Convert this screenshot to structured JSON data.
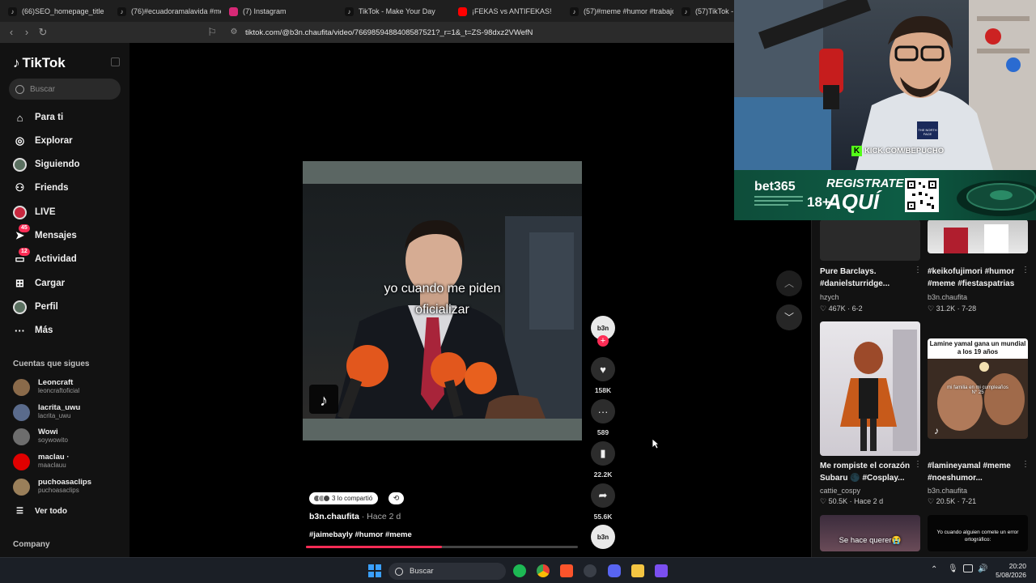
{
  "browser": {
    "tabs": [
      {
        "title": "(66)SEO_homepage_title",
        "color": "#111111",
        "icon": "tiktok-icon"
      },
      {
        "title": "(76)#ecuadoramalavida #med",
        "color": "#111111",
        "icon": "tiktok-icon"
      },
      {
        "title": "(7) Instagram",
        "color": "#d62976",
        "icon": "instagram-icon"
      },
      {
        "title": "TikTok - Make Your Day",
        "color": "#111111",
        "icon": "tiktok-icon"
      },
      {
        "title": "¡FEKAS vs ANTIFEKAS!",
        "color": "#ff0000",
        "icon": "youtube-icon"
      },
      {
        "title": "(57)#meme #humor #trabajo",
        "color": "#111111",
        "icon": "tiktok-icon"
      },
      {
        "title": "(57)TikTok -",
        "color": "#111111",
        "icon": "tiktok-icon"
      }
    ],
    "url": "tiktok.com/@b3n.chaufita/video/7669859488408587521?_r=1&_t=ZS-98dxz2VWefN"
  },
  "sidebar": {
    "logo": "TikTok",
    "search_placeholder": "Buscar",
    "nav": [
      {
        "label": "Para ti",
        "icon": "home-icon",
        "glyph": "⌂"
      },
      {
        "label": "Explorar",
        "icon": "compass-icon",
        "glyph": "◎"
      },
      {
        "label": "Siguiendo",
        "icon": "following-avatar-icon",
        "glyph": ""
      },
      {
        "label": "Friends",
        "icon": "friends-icon",
        "glyph": "⚇"
      },
      {
        "label": "LIVE",
        "icon": "live-avatar-icon",
        "glyph": ""
      },
      {
        "label": "Mensajes",
        "icon": "messages-icon",
        "glyph": "➤",
        "badge": "45"
      },
      {
        "label": "Actividad",
        "icon": "activity-icon",
        "glyph": "▭",
        "badge": "12"
      },
      {
        "label": "Cargar",
        "icon": "upload-icon",
        "glyph": "⊞"
      },
      {
        "label": "Perfil",
        "icon": "profile-avatar-icon",
        "glyph": ""
      },
      {
        "label": "Más",
        "icon": "more-icon",
        "glyph": "···"
      }
    ],
    "following_title": "Cuentas que sigues",
    "following": [
      {
        "name": "Leoncraft",
        "handle": "leoncraftoficial",
        "color": "#8a6a4a"
      },
      {
        "name": "lacrita_uwu",
        "handle": "lacrita_uwu",
        "color": "#5a6b8c"
      },
      {
        "name": "Wowi",
        "handle": "soywowito",
        "color": "#6d6d6d"
      },
      {
        "name": "maclau ·",
        "handle": "maaclauu",
        "color": "#e00000"
      },
      {
        "name": "puchoasaclips",
        "handle": "puchoasaclips",
        "color": "#9a7f5a"
      }
    ],
    "see_all": "Ver todo",
    "company": "Company"
  },
  "video": {
    "caption_line1": "yo cuando me piden",
    "caption_line2": "oficializar",
    "progress": 0.5,
    "shared_text": "3 lo compartió",
    "author": "b3n.chaufita",
    "time": "· Hace 2 d",
    "tags": "#jaimebayly #humor #meme",
    "avatar_text": "b3n"
  },
  "actions": {
    "likes": "158K",
    "comments": "589",
    "saves": "22.2K",
    "shares": "55.6K"
  },
  "right_cards": [
    {
      "title": "Pure Barclays. #danielsturridge...",
      "user": "hzych",
      "stats": "♡ 467K · 6-2"
    },
    {
      "title": "#keikofujimori #humor #meme #fiestaspatrias",
      "user": "b3n.chaufita",
      "stats": "♡ 31.2K · 7-28"
    },
    {
      "title": "Me rompiste el corazón Subaru 🌑 #Cosplay...",
      "user": "cattie_cospy",
      "stats": "♡ 50.5K · Hace 2 d"
    },
    {
      "title": "#lamineyamal #meme #noeshumor...",
      "user": "b3n.chaufita",
      "stats": "♡ 20.5K · 7-21"
    }
  ],
  "thumb_texts": {
    "lamine_top": "Lamine yamal gana un mundial a los 19 años",
    "lamine_mid": "mi familia en mi cumpleaños N° 25",
    "bottom_left": "Se hace querer😭",
    "bottom_right": "Yo cuando alguien comete un error ortográfico:"
  },
  "stream_overlay": {
    "kick": "KICK.COM/BEPUCHO",
    "hoodie": "THE NORTH FACE",
    "ad_brand": "bet365",
    "ad_age": "18+",
    "ad_cta_line1": "REGISTRATE",
    "ad_cta_line2": "AQUÍ"
  },
  "taskbar": {
    "search": "Buscar",
    "time": "20:20",
    "date": "5/08/2026"
  }
}
